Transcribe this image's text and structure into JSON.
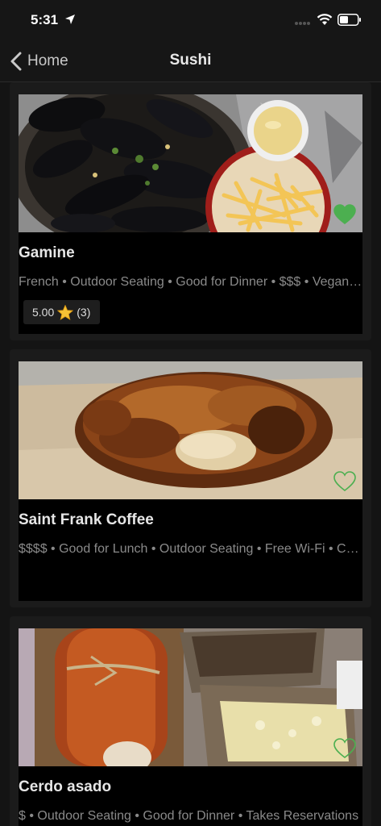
{
  "status": {
    "time": "5:31"
  },
  "nav": {
    "back_label": "Home",
    "title": "Sushi"
  },
  "restaurants": [
    {
      "name": "Gamine",
      "tags": "French • Outdoor Seating • Good for Dinner • $$$ • Vegan Options",
      "rating": "5.00",
      "review_count": "(3)",
      "favorited": true,
      "photo_icon": "mussels-and-fries-photo"
    },
    {
      "name": "Saint Frank Coffee",
      "tags": "$$$$ • Good for Lunch • Outdoor Seating • Free Wi-Fi • Coffee",
      "favorited": false,
      "photo_icon": "pastry-photo"
    },
    {
      "name": "Cerdo asado",
      "tags": "$ • Outdoor Seating • Good for Dinner • Takes Reservations",
      "favorited": false,
      "photo_icon": "roast-pork-photo"
    }
  ],
  "colors": {
    "favorite_green": "#4caf50",
    "background": "#141414",
    "card_background": "#000000",
    "muted_text": "#8a8a8a"
  }
}
